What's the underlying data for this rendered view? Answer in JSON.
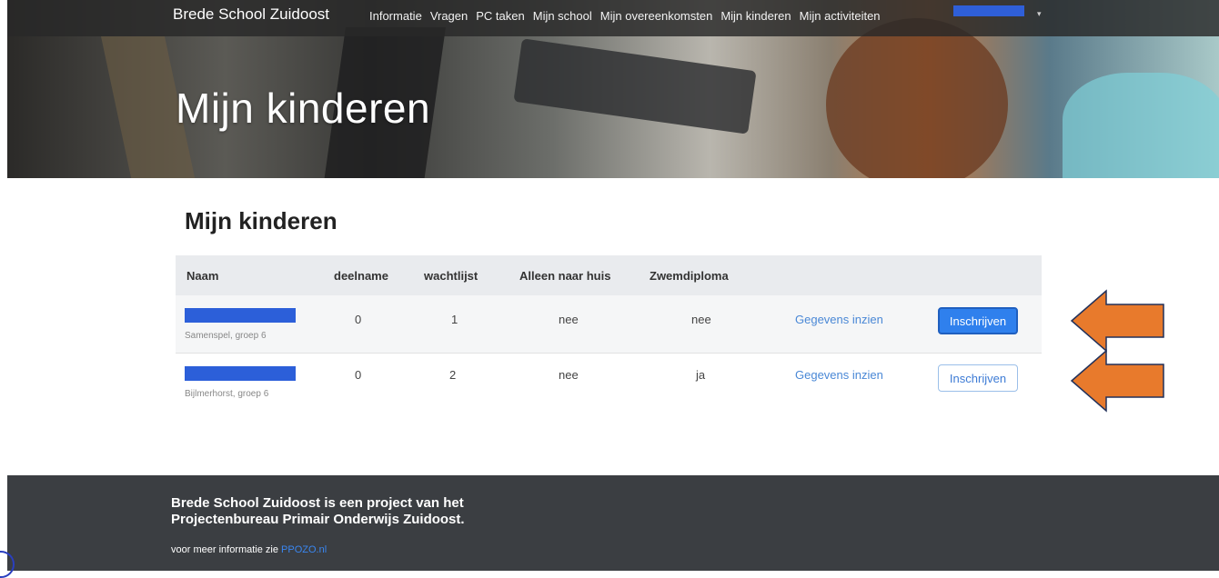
{
  "navbar": {
    "brand": "Brede School Zuidoost",
    "links": [
      "Informatie",
      "Vragen",
      "PC taken",
      "Mijn school",
      "Mijn overeenkomsten",
      "Mijn kinderen",
      "Mijn activiteiten"
    ],
    "user_caret": "▾"
  },
  "hero": {
    "title": "Mijn kinderen"
  },
  "main": {
    "title": "Mijn kinderen",
    "columns": [
      "Naam",
      "deelname",
      "wachtlijst",
      "Alleen naar huis",
      "Zwemdiploma"
    ],
    "rows": [
      {
        "sub": "Samenspel, groep 6",
        "deelname": "0",
        "wachtlijst": "1",
        "alleen": "nee",
        "zwem": "nee",
        "link": "Gegevens inzien",
        "button": "Inschrijven"
      },
      {
        "sub": "Bijlmerhorst, groep 6",
        "deelname": "0",
        "wachtlijst": "2",
        "alleen": "nee",
        "zwem": "ja",
        "link": "Gegevens inzien",
        "button": "Inschrijven"
      }
    ]
  },
  "footer": {
    "line1": "Brede School Zuidoost is een project van het",
    "line2": "Projectenbureau Primair Onderwijs Zuidoost.",
    "info_text": "voor meer informatie zie ",
    "info_link": "PPOZO.nl"
  },
  "colors": {
    "accent": "#2f80ed",
    "arrow": "#e87a2c",
    "redaction": "#2c5fd9",
    "footer": "#3b3e42"
  }
}
